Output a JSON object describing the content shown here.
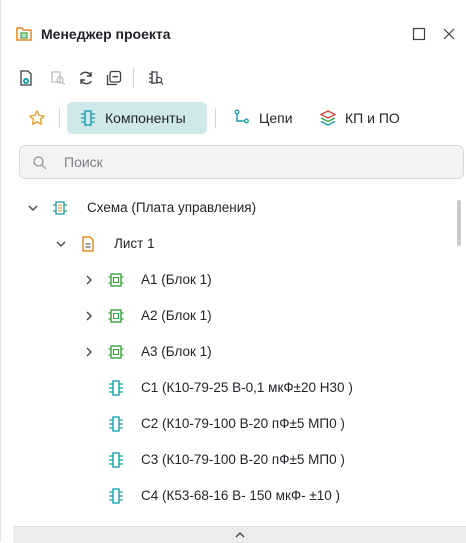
{
  "panel": {
    "title": "Менеджер проекта",
    "maximize_icon": "maximize-icon",
    "close_icon": "close-icon"
  },
  "toolbar": {
    "icons": [
      "properties-icon",
      "locate-icon",
      "refresh-icon",
      "collapse-all-icon",
      "find-component-icon"
    ]
  },
  "tabs": [
    {
      "label": "",
      "icon": "star-icon",
      "active": false
    },
    {
      "label": "Компоненты",
      "icon": "component-icon",
      "active": true
    },
    {
      "label": "Цепи",
      "icon": "net-icon",
      "active": false
    },
    {
      "label": "КП и ПО",
      "icon": "layers-icon",
      "active": false
    }
  ],
  "search": {
    "placeholder": "Поиск",
    "value": ""
  },
  "tree": [
    {
      "label": "Схема (Плата управления)",
      "icon": "schematic-icon",
      "expanded": true,
      "level": 0
    },
    {
      "label": "Лист 1",
      "icon": "sheet-icon",
      "expanded": true,
      "level": 1
    },
    {
      "label": "A1 (Блок 1)",
      "icon": "block-icon",
      "expanded": false,
      "level": 2
    },
    {
      "label": "A2 (Блок 1)",
      "icon": "block-icon",
      "expanded": false,
      "level": 2
    },
    {
      "label": "A3 (Блок 1)",
      "icon": "block-icon",
      "expanded": false,
      "level": 2
    },
    {
      "label": "C1 (К10-79-25 В-0,1 мкФ±20 Н30 )",
      "icon": "capacitor-icon",
      "level": 3
    },
    {
      "label": "C2 (К10-79-100 В-20 пФ±5 МП0 )",
      "icon": "capacitor-icon",
      "level": 3
    },
    {
      "label": "C3 (К10-79-100 В-20 пФ±5 МП0 )",
      "icon": "capacitor-icon",
      "level": 3
    },
    {
      "label": "C4 (К53-68-16 В- 150 мкФ- ±10 )",
      "icon": "capacitor-icon",
      "level": 3
    }
  ],
  "colors": {
    "accent": "#1a9fa8",
    "active_tab_bg": "#cfe8ea",
    "block_green": "#3aa03e",
    "sheet_orange": "#e08a1e",
    "layers_red": "#d9453c",
    "star_orange": "#e09a25"
  }
}
